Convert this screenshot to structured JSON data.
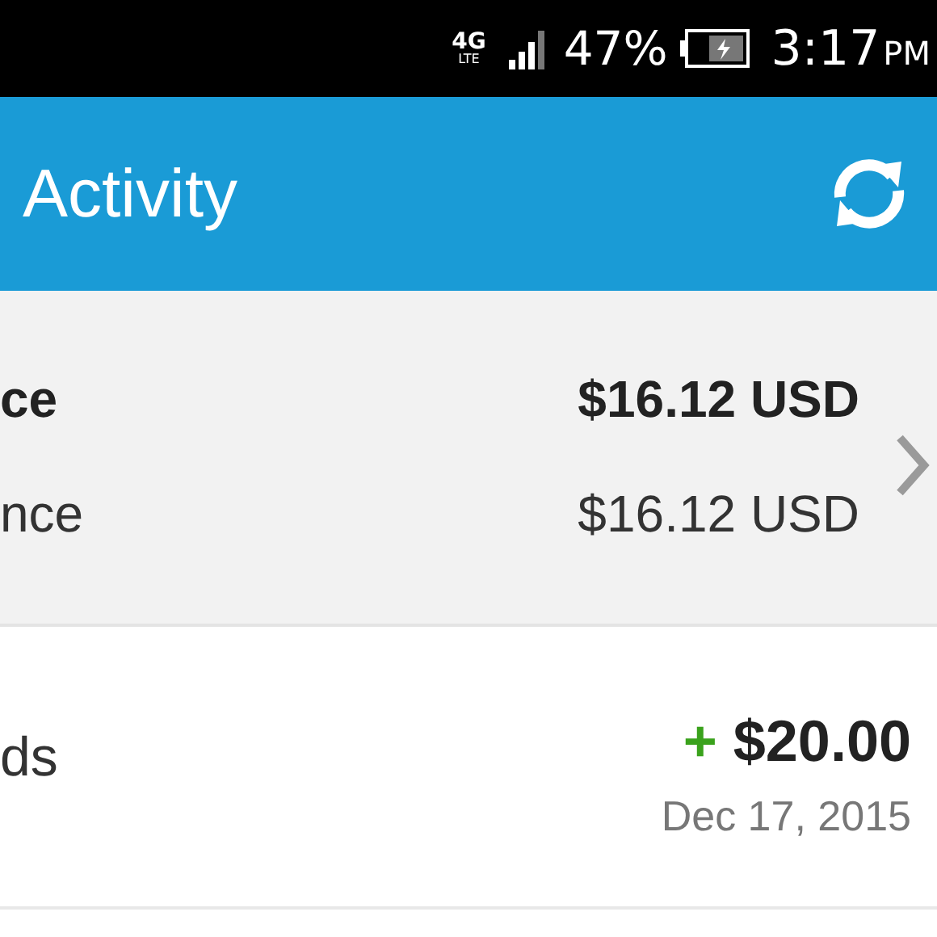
{
  "status_bar": {
    "network_type": "4G",
    "network_sub": "LTE",
    "battery": "47%",
    "time": "3:17",
    "meridiem": "PM"
  },
  "app_bar": {
    "title": "Activity"
  },
  "balance": {
    "rows": [
      {
        "label": "ce",
        "amount": "$16.12 USD",
        "kind": "primary"
      },
      {
        "label": "nce",
        "amount": "$16.12 USD",
        "kind": "secondary"
      }
    ]
  },
  "transactions": [
    {
      "label": "ds",
      "sign": "+",
      "amount": "$20.00",
      "date": "Dec 17, 2015",
      "kind": "credit"
    }
  ]
}
